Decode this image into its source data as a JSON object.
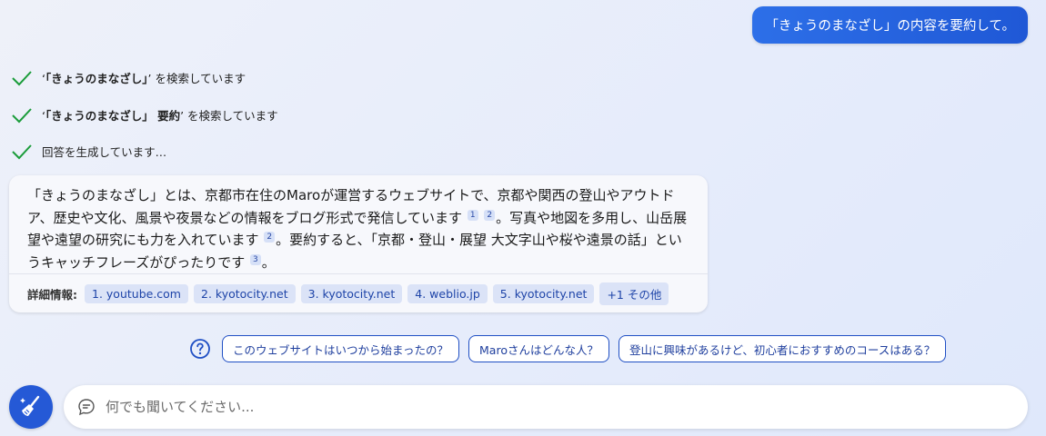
{
  "user_message": "「きょうのまなざし」の内容を要約して。",
  "status": [
    {
      "prefix": "‘",
      "bold": "「きょうのまなざし」",
      "suffix": "’ を検索しています"
    },
    {
      "prefix": "‘",
      "bold": "「きょうのまなざし」 要約",
      "suffix": "’ を検索しています"
    },
    {
      "prefix": "",
      "bold": "",
      "suffix": "回答を生成しています…"
    }
  ],
  "answer": {
    "seg1": "「きょうのまなざし」とは、京都市在住のMaroが運営するウェブサイトで、京都や関西の登山やアウトドア、歴史や文化、風景や夜景などの情報をブログ形式で発信しています",
    "cite1": "1",
    "cite2": "2",
    "seg2": "。写真や地図を多用し、山岳展望や遠望の研究にも力を入れています",
    "cite3": "2",
    "seg3": "。要約すると、「京都・登山・展望 大文字山や桜や遠景の話」というキャッチフレーズがぴったりです",
    "cite4": "3",
    "seg4": "。"
  },
  "details": {
    "label": "詳細情報:",
    "sources": [
      "1. youtube.com",
      "2. kyotocity.net",
      "3. kyotocity.net",
      "4. weblio.jp",
      "5. kyotocity.net",
      "+1 その他"
    ]
  },
  "suggestions": [
    "このウェブサイトはいつから始まったの？",
    "Maroさんはどんな人？",
    "登山に興味があるけど、初心者におすすめのコースはある？"
  ],
  "input": {
    "placeholder": "何でも聞いてください..."
  },
  "colors": {
    "accent": "#2559d6",
    "check": "#1a9c3a",
    "chip_bg": "#dbe3f7"
  }
}
